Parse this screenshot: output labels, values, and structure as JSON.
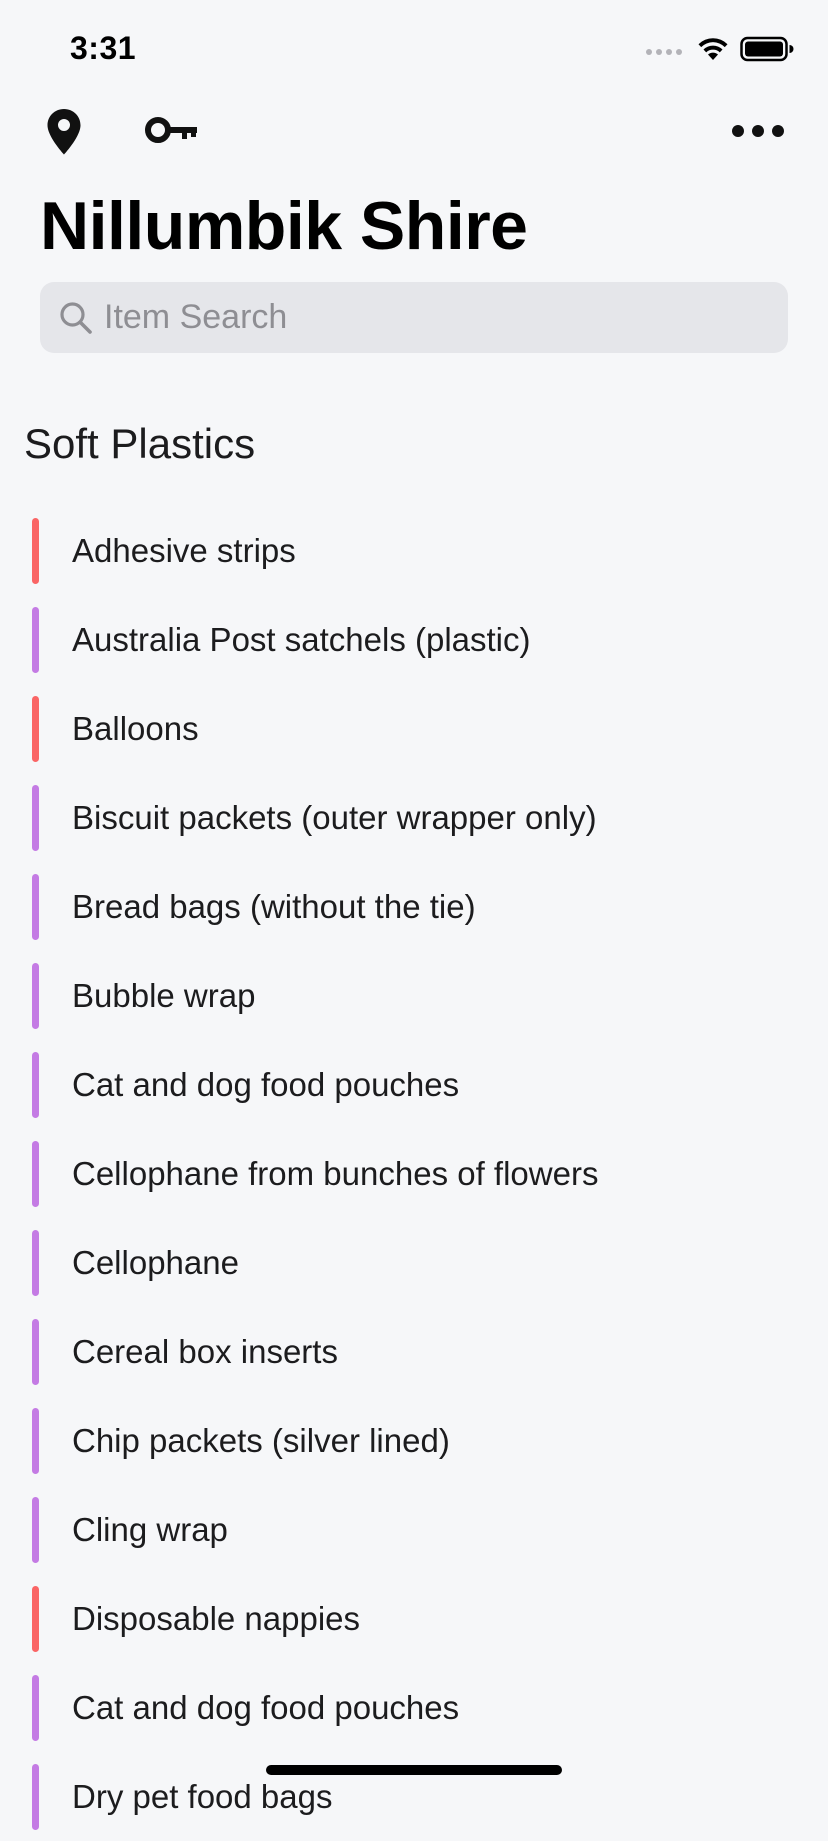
{
  "status_bar": {
    "time": "3:31"
  },
  "nav": {
    "location_icon": "location-pin-icon",
    "key_icon": "key-icon",
    "more_icon": "ellipsis-icon"
  },
  "title": "Nillumbik Shire",
  "search": {
    "placeholder": "Item Search",
    "value": ""
  },
  "section": {
    "title": "Soft Plastics"
  },
  "colors": {
    "red": "#fa6565",
    "purple": "#c47be4",
    "background": "#f6f7f9",
    "search_bg": "#e5e6ea"
  },
  "items": [
    {
      "label": "Adhesive strips",
      "color": "red"
    },
    {
      "label": "Australia Post satchels (plastic)",
      "color": "purple"
    },
    {
      "label": "Balloons",
      "color": "red"
    },
    {
      "label": "Biscuit packets (outer wrapper only)",
      "color": "purple"
    },
    {
      "label": "Bread bags (without the tie)",
      "color": "purple"
    },
    {
      "label": "Bubble wrap",
      "color": "purple"
    },
    {
      "label": "Cat and dog food pouches",
      "color": "purple"
    },
    {
      "label": "Cellophane from bunches of flowers",
      "color": "purple"
    },
    {
      "label": "Cellophane",
      "color": "purple"
    },
    {
      "label": "Cereal box inserts",
      "color": "purple"
    },
    {
      "label": "Chip packets (silver lined)",
      "color": "purple"
    },
    {
      "label": "Cling wrap",
      "color": "purple"
    },
    {
      "label": "Disposable nappies",
      "color": "red"
    },
    {
      "label": "Cat and dog food pouches",
      "color": "purple"
    },
    {
      "label": "Dry pet food bags",
      "color": "purple"
    }
  ]
}
